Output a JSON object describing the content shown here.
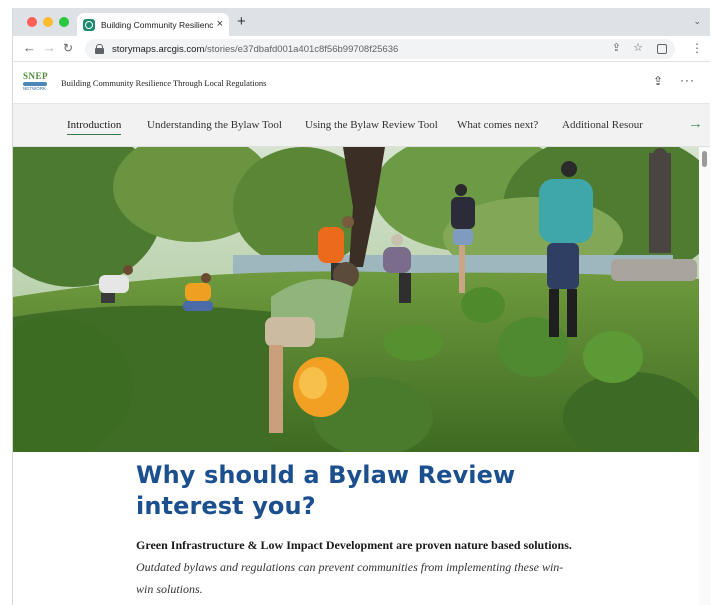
{
  "browser": {
    "tab_title": "Building Community Resilienc",
    "tab_close": "×",
    "new_tab": "+",
    "tab_menu": "⌄",
    "url_host": "storymaps.arcgis.com",
    "url_path": "/stories/e37dbafd001a401c8f56b99708f25636",
    "icons": [
      "back-arrow-icon",
      "forward-arrow-icon",
      "reload-icon",
      "lock-icon",
      "share-icon",
      "star-icon",
      "side-panel-icon",
      "kebab-menu-icon"
    ]
  },
  "header": {
    "logo_top": "SNEP",
    "logo_bottom": "NETWORK",
    "title": "Building Community Resilience Through Local Regulations",
    "share_icon": "share-icon",
    "more_icon": "more-icon",
    "more_label": "···"
  },
  "story_nav": {
    "items": [
      {
        "label": "Introduction",
        "active": true
      },
      {
        "label": "Understanding the Bylaw Tool"
      },
      {
        "label": "Using the Bylaw Review Tool"
      },
      {
        "label": "What comes next?"
      },
      {
        "label": "Additional Resour"
      }
    ],
    "next_arrow": "→"
  },
  "hero": {
    "description_icon": "photo-volunteers-planting"
  },
  "article": {
    "heading": "Why should a Bylaw Review interest you?",
    "para_bold": "Green Infrastructure & Low Impact Development are proven nature based solutions.",
    "para_italic": "Outdated bylaws and regulations can prevent communities from implementing these win-win solutions."
  },
  "colors": {
    "heading": "#1b4f8e",
    "nav_active_underline": "#3a7a4a",
    "arrow": "#4a9a5e"
  }
}
